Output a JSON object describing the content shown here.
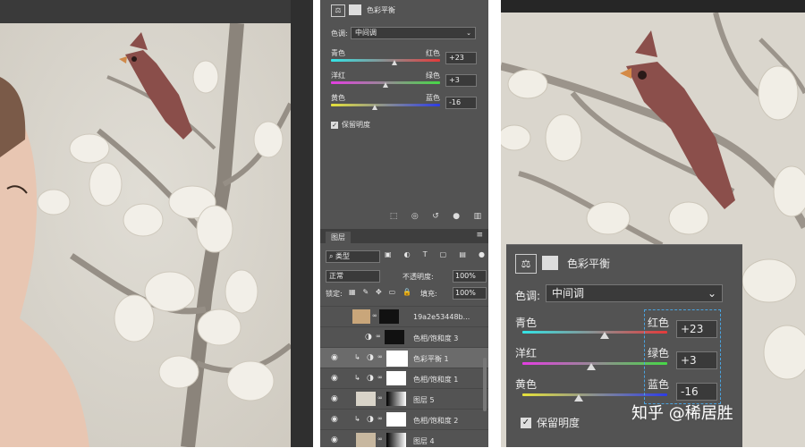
{
  "color_balance": {
    "title": "色彩平衡",
    "tone_label": "色调:",
    "tone_value": "中间调",
    "sliders": [
      {
        "left": "青色",
        "right": "红色",
        "value": "+23",
        "position": 0.62
      },
      {
        "left": "洋红",
        "right": "绿色",
        "value": "+3",
        "position": 0.52
      },
      {
        "left": "黄色",
        "right": "蓝色",
        "value": "-16",
        "position": 0.42
      }
    ],
    "preserve_label": "保留明度"
  },
  "layers": {
    "tab": "图层",
    "filter_label": "类型",
    "blend_mode": "正常",
    "opacity_label": "不透明度:",
    "opacity_value": "100%",
    "lock_label": "锁定:",
    "fill_label": "填充:",
    "fill_value": "100%",
    "items": [
      {
        "name": "19a2e53448b...",
        "visible": false
      },
      {
        "name": "色相/饱和度 3",
        "visible": false
      },
      {
        "name": "色彩平衡 1",
        "visible": true
      },
      {
        "name": "色相/饱和度 1",
        "visible": true
      },
      {
        "name": "图层 5",
        "visible": true
      },
      {
        "name": "色相/饱和度 2",
        "visible": true
      },
      {
        "name": "图层 4",
        "visible": true
      }
    ]
  },
  "watermark": "知乎 @稀居胜",
  "colors": {
    "panel": "#535353",
    "field": "#3a3a3a",
    "selected_row": "#6b6b6b"
  }
}
